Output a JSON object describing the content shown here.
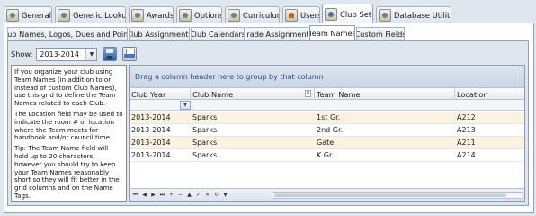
{
  "main_tabs": [
    {
      "label": "General",
      "icon": "general-icon"
    },
    {
      "label": "Generic Lookups",
      "icon": "lookups-icon"
    },
    {
      "label": "Awards",
      "icon": "awards-icon"
    },
    {
      "label": "Options",
      "icon": "options-icon"
    },
    {
      "label": "Curriculum",
      "icon": "curriculum-icon"
    },
    {
      "label": "Users",
      "icon": "users-icon"
    },
    {
      "label": "Club Setup",
      "icon": "club-setup-icon"
    },
    {
      "label": "Database Utilities",
      "icon": "database-icon"
    }
  ],
  "active_main_tab": "Club Setup",
  "sub_tabs": [
    {
      "label": "Club Names, Logos, Dues and Points"
    },
    {
      "label": "Club Assignments"
    },
    {
      "label": "Club Calendars"
    },
    {
      "label": "Grade Assignments"
    },
    {
      "label": "Team Names"
    },
    {
      "label": "Custom Fields"
    }
  ],
  "active_sub_tab": "Team Names",
  "toolbar": {
    "show_label": "Show:",
    "show_value": "2013-2014"
  },
  "help": {
    "p1": "If you organize your club using Team Names (in addition to or instead of custom Club Names), use this grid to define the Team Names related to each Club.",
    "p2": "The Location field may be used to indicate the room # or location where the Team meets for handbook and/or council time.",
    "p3": "Tip: The Team Name field will hold up to 20 characters, however you should try to keep your Team Names reasonably short so they will fit better in the grid columns and on the Name Tags."
  },
  "grid": {
    "group_hint": "Drag a column header here to group by that column",
    "columns": [
      "Club Year",
      "Club Name",
      "Team Name",
      "Location"
    ],
    "rows": [
      [
        "2013-2014",
        "Sparks",
        "1st Gr.",
        "A212"
      ],
      [
        "2013-2014",
        "Sparks",
        "2nd Gr.",
        "A213"
      ],
      [
        "2013-2014",
        "Sparks",
        "Gate",
        "A211"
      ],
      [
        "2013-2014",
        "Sparks",
        "K Gr.",
        "A214"
      ]
    ]
  },
  "navigator": {
    "buttons": [
      "⏮",
      "◀",
      "▶",
      "⏭",
      "+",
      "−",
      "▲",
      "✓",
      "✕",
      "↻",
      "▼"
    ]
  }
}
